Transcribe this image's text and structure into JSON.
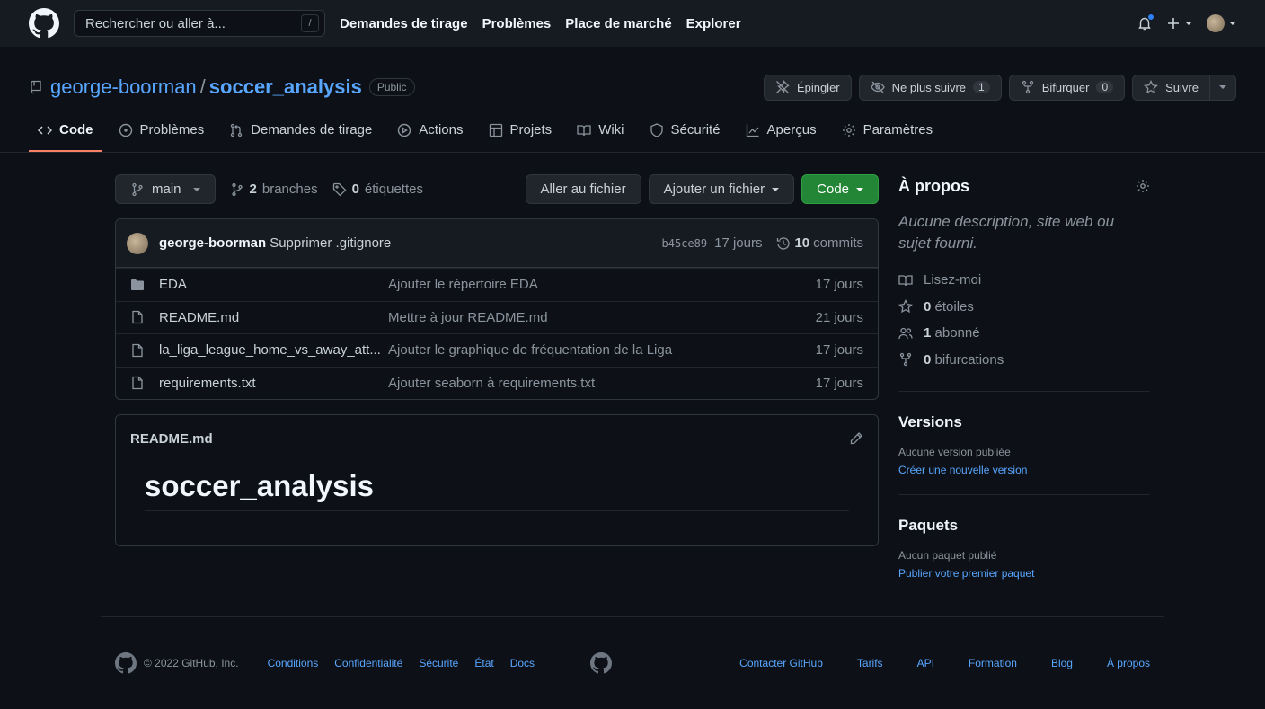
{
  "header": {
    "search_placeholder": "Rechercher ou aller à...",
    "search_key": "/",
    "nav": [
      "Demandes de tirage",
      "Problèmes",
      "Place de marché",
      "Explorer"
    ]
  },
  "repo": {
    "owner": "george-boorman",
    "sep": "/",
    "name": "soccer_analysis",
    "visibility": "Public",
    "pin_label": "Épingler",
    "watch_label": "Ne plus suivre",
    "watch_count": "1",
    "fork_label": "Bifurquer",
    "fork_count": "0",
    "star_label": "Suivre"
  },
  "tabs": [
    "Code",
    "Problèmes",
    "Demandes de tirage",
    "Actions",
    "Projets",
    "Wiki",
    "Sécurité",
    "Aperçus",
    "Paramètres"
  ],
  "bar": {
    "branch": "main",
    "branches_count": "2",
    "branches_label": "branches",
    "tags_count": "0",
    "tags_label": "étiquettes",
    "goto_file": "Aller au fichier",
    "add_file": "Ajouter un fichier",
    "code": "Code"
  },
  "commit": {
    "author": "george-boorman",
    "message": "Supprimer .gitignore",
    "sha": "b45ce89",
    "age": "17 jours",
    "commits_count": "10",
    "commits_label": "commits"
  },
  "files": [
    {
      "type": "folder",
      "name": "EDA",
      "message": "Ajouter le répertoire EDA",
      "age": "17 jours"
    },
    {
      "type": "file",
      "name": "README.md",
      "message": "Mettre à jour README.md",
      "age": "21 jours"
    },
    {
      "type": "file",
      "name": "la_liga_league_home_vs_away_att...",
      "message": "Ajouter le graphique de fréquentation de la Liga",
      "age": "17 jours"
    },
    {
      "type": "file",
      "name": "requirements.txt",
      "message": "Ajouter seaborn à requirements.txt",
      "age": "17 jours"
    }
  ],
  "readme": {
    "filename": "README.md",
    "title": "soccer_analysis"
  },
  "about": {
    "title": "À propos",
    "description": "Aucune description, site web ou sujet fourni.",
    "readme": "Lisez-moi",
    "stars_count": "0",
    "stars_label": "étoiles",
    "watchers_count": "1",
    "watchers_label": "abonné",
    "forks_count": "0",
    "forks_label": "bifurcations"
  },
  "releases": {
    "title": "Versions",
    "none": "Aucune version publiée",
    "create": "Créer une nouvelle version"
  },
  "packages": {
    "title": "Paquets",
    "none": "Aucun paquet publié",
    "publish": "Publier votre premier paquet"
  },
  "footer": {
    "copyright": "© 2022 GitHub, Inc.",
    "links_left": [
      "Conditions",
      "Confidentialité",
      "Sécurité",
      "État",
      "Docs"
    ],
    "links_right": [
      "Contacter GitHub",
      "Tarifs",
      "API",
      "Formation",
      "Blog",
      "À propos"
    ]
  },
  "colors": {
    "background": "#0d1117",
    "header": "#161b22",
    "link": "#58a6ff",
    "accent_tab": "#f78166",
    "green_button": "#238636",
    "notification": "#2f81f7"
  }
}
